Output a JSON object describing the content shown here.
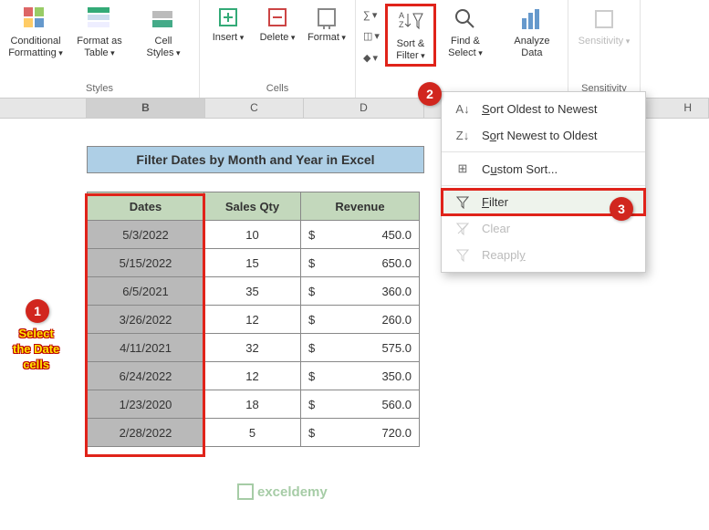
{
  "ribbon": {
    "styles": {
      "cond_fmt": "Conditional\nFormatting",
      "fmt_table": "Format as\nTable",
      "cell_styles": "Cell\nStyles",
      "label": "Styles"
    },
    "cells": {
      "insert": "Insert",
      "delete": "Delete",
      "format": "Format",
      "label": "Cells"
    },
    "editing": {
      "sort_filter": "Sort &\nFilter",
      "find_select": "Find &\nSelect"
    },
    "analysis": {
      "analyze": "Analyze\nData"
    },
    "sensitivity": {
      "sens": "Sensitivity",
      "label": "Sensitivity"
    }
  },
  "columns": {
    "B": "B",
    "C": "C",
    "D": "D",
    "H": "H"
  },
  "banner": "Filter Dates by Month and Year in Excel",
  "headers": {
    "dates": "Dates",
    "qty": "Sales Qty",
    "rev": "Revenue"
  },
  "rows": [
    {
      "date": "5/3/2022",
      "qty": "10",
      "cur": "$",
      "rev": "450.0"
    },
    {
      "date": "5/15/2022",
      "qty": "15",
      "cur": "$",
      "rev": "650.0"
    },
    {
      "date": "6/5/2021",
      "qty": "35",
      "cur": "$",
      "rev": "360.0"
    },
    {
      "date": "3/26/2022",
      "qty": "12",
      "cur": "$",
      "rev": "260.0"
    },
    {
      "date": "4/11/2021",
      "qty": "32",
      "cur": "$",
      "rev": "575.0"
    },
    {
      "date": "6/24/2022",
      "qty": "12",
      "cur": "$",
      "rev": "350.0"
    },
    {
      "date": "1/23/2020",
      "qty": "18",
      "cur": "$",
      "rev": "560.0"
    },
    {
      "date": "2/28/2022",
      "qty": "5",
      "cur": "$",
      "rev": "720.0"
    }
  ],
  "menu": {
    "sort_on": "Sort Oldest to Newest",
    "sort_no": "Sort Newest to Oldest",
    "custom": "Custom Sort...",
    "filter": "Filter",
    "clear": "Clear",
    "reapply": "Reapply"
  },
  "callouts": {
    "one": "1",
    "two": "2",
    "three": "3",
    "select_text": "Select\nthe Date\ncells"
  },
  "watermark": "exceldemy"
}
